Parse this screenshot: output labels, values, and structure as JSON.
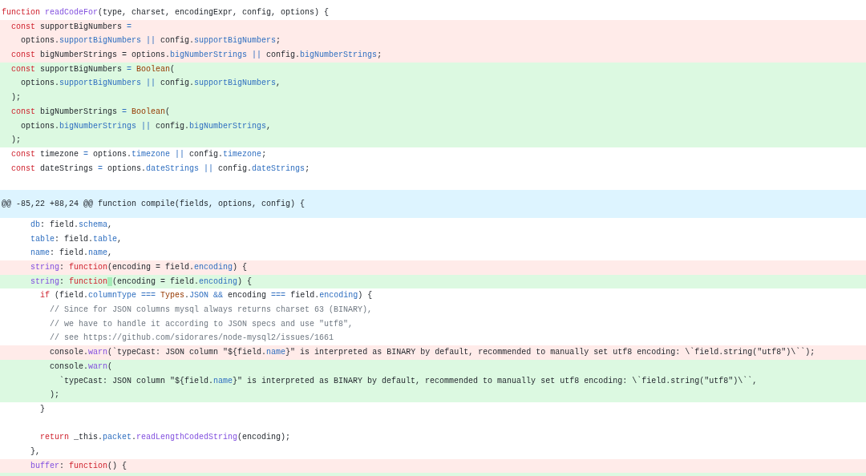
{
  "diff": {
    "lines": [
      {
        "kind": "context",
        "tokens": [
          {
            "kind": "keyword",
            "text": "function "
          },
          {
            "kind": "func",
            "text": "readCodeFor"
          },
          {
            "kind": "plain",
            "text": "(type, charset, encodingExpr, config, options) {"
          }
        ]
      },
      {
        "kind": "removed",
        "tokens": [
          {
            "kind": "keyword",
            "text": "  const"
          },
          {
            "kind": "plain",
            "text": " supportBigNumbers "
          },
          {
            "kind": "prop",
            "text": "="
          }
        ]
      },
      {
        "kind": "removed",
        "tokens": [
          {
            "kind": "plain",
            "text": "    options."
          },
          {
            "kind": "prop",
            "text": "supportBigNumbers "
          },
          {
            "kind": "prop",
            "text": "||"
          },
          {
            "kind": "plain",
            "text": " config."
          },
          {
            "kind": "prop",
            "text": "supportBigNumbers"
          },
          {
            "kind": "plain",
            "text": ";"
          }
        ]
      },
      {
        "kind": "removed",
        "tokens": [
          {
            "kind": "keyword",
            "text": "  const"
          },
          {
            "kind": "plain",
            "text": " bigNumberStrings = options."
          },
          {
            "kind": "prop",
            "text": "bigNumberStrings "
          },
          {
            "kind": "prop",
            "text": "||"
          },
          {
            "kind": "plain",
            "text": " config."
          },
          {
            "kind": "prop",
            "text": "bigNumberStrings"
          },
          {
            "kind": "plain",
            "text": ";"
          }
        ]
      },
      {
        "kind": "added",
        "tokens": [
          {
            "kind": "keyword",
            "text": "  const"
          },
          {
            "kind": "plain",
            "text": " supportBigNumbers "
          },
          {
            "kind": "prop",
            "text": "= "
          },
          {
            "kind": "type",
            "text": "Boolean"
          },
          {
            "kind": "plain",
            "text": "("
          }
        ]
      },
      {
        "kind": "added",
        "tokens": [
          {
            "kind": "plain",
            "text": "    options."
          },
          {
            "kind": "prop",
            "text": "supportBigNumbers "
          },
          {
            "kind": "prop",
            "text": "||"
          },
          {
            "kind": "plain",
            "text": " config."
          },
          {
            "kind": "prop",
            "text": "supportBigNumbers"
          },
          {
            "kind": "plain",
            "text": ","
          }
        ]
      },
      {
        "kind": "added",
        "tokens": [
          {
            "kind": "plain",
            "text": "  );"
          }
        ]
      },
      {
        "kind": "added",
        "tokens": [
          {
            "kind": "keyword",
            "text": "  const"
          },
          {
            "kind": "plain",
            "text": " bigNumberStrings "
          },
          {
            "kind": "prop",
            "text": "= "
          },
          {
            "kind": "type",
            "text": "Boolean"
          },
          {
            "kind": "plain",
            "text": "("
          }
        ]
      },
      {
        "kind": "added",
        "tokens": [
          {
            "kind": "plain",
            "text": "    options."
          },
          {
            "kind": "prop",
            "text": "bigNumberStrings "
          },
          {
            "kind": "prop",
            "text": "||"
          },
          {
            "kind": "plain",
            "text": " config."
          },
          {
            "kind": "prop",
            "text": "bigNumberStrings"
          },
          {
            "kind": "plain",
            "text": ","
          }
        ]
      },
      {
        "kind": "added",
        "tokens": [
          {
            "kind": "plain",
            "text": "  );"
          }
        ]
      },
      {
        "kind": "context",
        "tokens": [
          {
            "kind": "keyword",
            "text": "  const"
          },
          {
            "kind": "plain",
            "text": " timezone "
          },
          {
            "kind": "prop",
            "text": "="
          },
          {
            "kind": "plain",
            "text": " options."
          },
          {
            "kind": "prop",
            "text": "timezone "
          },
          {
            "kind": "prop",
            "text": "||"
          },
          {
            "kind": "plain",
            "text": " config."
          },
          {
            "kind": "prop",
            "text": "timezone"
          },
          {
            "kind": "plain",
            "text": ";"
          }
        ]
      },
      {
        "kind": "context",
        "tokens": [
          {
            "kind": "keyword",
            "text": "  const"
          },
          {
            "kind": "plain",
            "text": " dateStrings "
          },
          {
            "kind": "prop",
            "text": "="
          },
          {
            "kind": "plain",
            "text": " options."
          },
          {
            "kind": "prop",
            "text": "dateStrings "
          },
          {
            "kind": "prop",
            "text": "||"
          },
          {
            "kind": "plain",
            "text": " config."
          },
          {
            "kind": "prop",
            "text": "dateStrings"
          },
          {
            "kind": "plain",
            "text": ";"
          }
        ]
      },
      {
        "kind": "context"
      },
      {
        "kind": "hunk",
        "tokens": [
          {
            "kind": "plain",
            "text": "@@ -85,22 +88,24 @@ function compile(fields, options, config) {"
          }
        ]
      },
      {
        "kind": "context",
        "tokens": [
          {
            "kind": "prop",
            "text": "      db"
          },
          {
            "kind": "plain",
            "text": ": field."
          },
          {
            "kind": "prop",
            "text": "schema"
          },
          {
            "kind": "plain",
            "text": ","
          }
        ]
      },
      {
        "kind": "context",
        "tokens": [
          {
            "kind": "prop",
            "text": "      table"
          },
          {
            "kind": "plain",
            "text": ": field."
          },
          {
            "kind": "prop",
            "text": "table"
          },
          {
            "kind": "plain",
            "text": ","
          }
        ]
      },
      {
        "kind": "context",
        "tokens": [
          {
            "kind": "prop",
            "text": "      name"
          },
          {
            "kind": "plain",
            "text": ": field."
          },
          {
            "kind": "prop",
            "text": "name"
          },
          {
            "kind": "plain",
            "text": ","
          }
        ]
      },
      {
        "kind": "removed",
        "tokens": [
          {
            "kind": "func",
            "text": "      string"
          },
          {
            "kind": "plain",
            "text": ": "
          },
          {
            "kind": "keyword",
            "text": "function"
          },
          {
            "kind": "plain",
            "text": "(encoding = field."
          },
          {
            "kind": "prop",
            "text": "encoding"
          },
          {
            "kind": "plain",
            "text": ") {"
          }
        ]
      },
      {
        "kind": "added",
        "tokens": [
          {
            "kind": "func",
            "text": "      string"
          },
          {
            "kind": "plain",
            "text": ": "
          },
          {
            "kind": "keyword",
            "text": "function"
          },
          {
            "kind": "plain",
            "text": " (encoding = field.",
            "leading_insert": true
          },
          {
            "kind": "prop",
            "text": "encoding"
          },
          {
            "kind": "plain",
            "text": ") {"
          }
        ]
      },
      {
        "kind": "context",
        "tokens": [
          {
            "kind": "keyword",
            "text": "        if"
          },
          {
            "kind": "plain",
            "text": " (field."
          },
          {
            "kind": "prop",
            "text": "columnType === "
          },
          {
            "kind": "type",
            "text": "Types"
          },
          {
            "kind": "plain",
            "text": "."
          },
          {
            "kind": "prop",
            "text": "JSON && "
          },
          {
            "kind": "plain",
            "text": "encoding "
          },
          {
            "kind": "prop",
            "text": "==="
          },
          {
            "kind": "plain",
            "text": " field."
          },
          {
            "kind": "prop",
            "text": "encoding"
          },
          {
            "kind": "plain",
            "text": ") {"
          }
        ]
      },
      {
        "kind": "context",
        "tokens": [
          {
            "kind": "comment",
            "text": "          // Since for JSON columns mysql always returns charset 63 (BINARY),"
          }
        ]
      },
      {
        "kind": "context",
        "tokens": [
          {
            "kind": "comment",
            "text": "          // we have to handle it according to JSON specs and use \"utf8\","
          }
        ]
      },
      {
        "kind": "context",
        "tokens": [
          {
            "kind": "comment",
            "text": "          // see https://github.com/sidorares/node-mysql2/issues/1661"
          }
        ]
      },
      {
        "kind": "removed",
        "tokens": [
          {
            "kind": "plain",
            "text": "          console."
          },
          {
            "kind": "func",
            "text": "warn"
          },
          {
            "kind": "plain",
            "text": "(`typeCast: JSON column \"${field."
          },
          {
            "kind": "prop",
            "text": "name"
          },
          {
            "kind": "plain",
            "text": "}\" is interpreted as BINARY by default, recommended to manually set utf8 encoding: \\`field.string(\"utf8\")\\``);"
          }
        ]
      },
      {
        "kind": "added",
        "tokens": [
          {
            "kind": "plain",
            "text": "          console."
          },
          {
            "kind": "func",
            "text": "warn"
          },
          {
            "kind": "plain",
            "text": "("
          }
        ]
      },
      {
        "kind": "added",
        "tokens": [
          {
            "kind": "plain",
            "text": "            `typeCast: JSON column \"${field."
          },
          {
            "kind": "prop",
            "text": "name"
          },
          {
            "kind": "plain",
            "text": "}\" is interpreted as BINARY by default, recommended to manually set utf8 encoding: \\`field.string(\"utf8\")\\``,"
          }
        ]
      },
      {
        "kind": "added",
        "tokens": [
          {
            "kind": "plain",
            "text": "          );"
          }
        ]
      },
      {
        "kind": "context",
        "tokens": [
          {
            "kind": "plain",
            "text": "        }"
          }
        ]
      },
      {
        "kind": "context"
      },
      {
        "kind": "context",
        "tokens": [
          {
            "kind": "keyword",
            "text": "        return"
          },
          {
            "kind": "plain",
            "text": " _this."
          },
          {
            "kind": "prop",
            "text": "packet"
          },
          {
            "kind": "plain",
            "text": "."
          },
          {
            "kind": "func",
            "text": "readLengthCodedString"
          },
          {
            "kind": "plain",
            "text": "(encoding);"
          }
        ]
      },
      {
        "kind": "context",
        "tokens": [
          {
            "kind": "plain",
            "text": "      },"
          }
        ]
      },
      {
        "kind": "removed",
        "tokens": [
          {
            "kind": "func",
            "text": "      buffer"
          },
          {
            "kind": "plain",
            "text": ": "
          },
          {
            "kind": "keyword",
            "text": "function"
          },
          {
            "kind": "plain",
            "text": "() {"
          }
        ]
      },
      {
        "kind": "added"
      }
    ]
  }
}
